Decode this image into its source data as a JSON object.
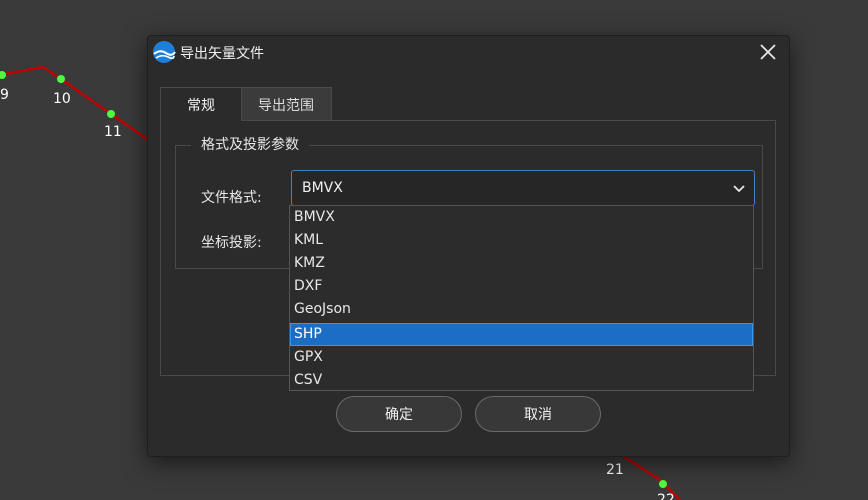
{
  "map": {
    "labels": {
      "p9": "9",
      "p10": "10",
      "p11": "11",
      "p21": "21",
      "p22": "22"
    },
    "colors": {
      "line": "#c00000",
      "point": "#4cff3c"
    }
  },
  "dialog": {
    "title": "导出矢量文件",
    "tabs": [
      {
        "label": "常规"
      },
      {
        "label": "导出范围"
      }
    ],
    "group_title": "格式及投影参数",
    "format_label": "文件格式:",
    "format_value": "BMVX",
    "projection_label": "坐标投影:",
    "dropdown_options": [
      "BMVX",
      "KML",
      "KMZ",
      "DXF",
      "GeoJson",
      "SHP",
      "GPX",
      "CSV"
    ],
    "highlighted_option": "SHP",
    "ok_label": "确定",
    "cancel_label": "取消",
    "colors": {
      "accent": "#1c6ec4",
      "focus_border": "#3b85c9"
    }
  }
}
